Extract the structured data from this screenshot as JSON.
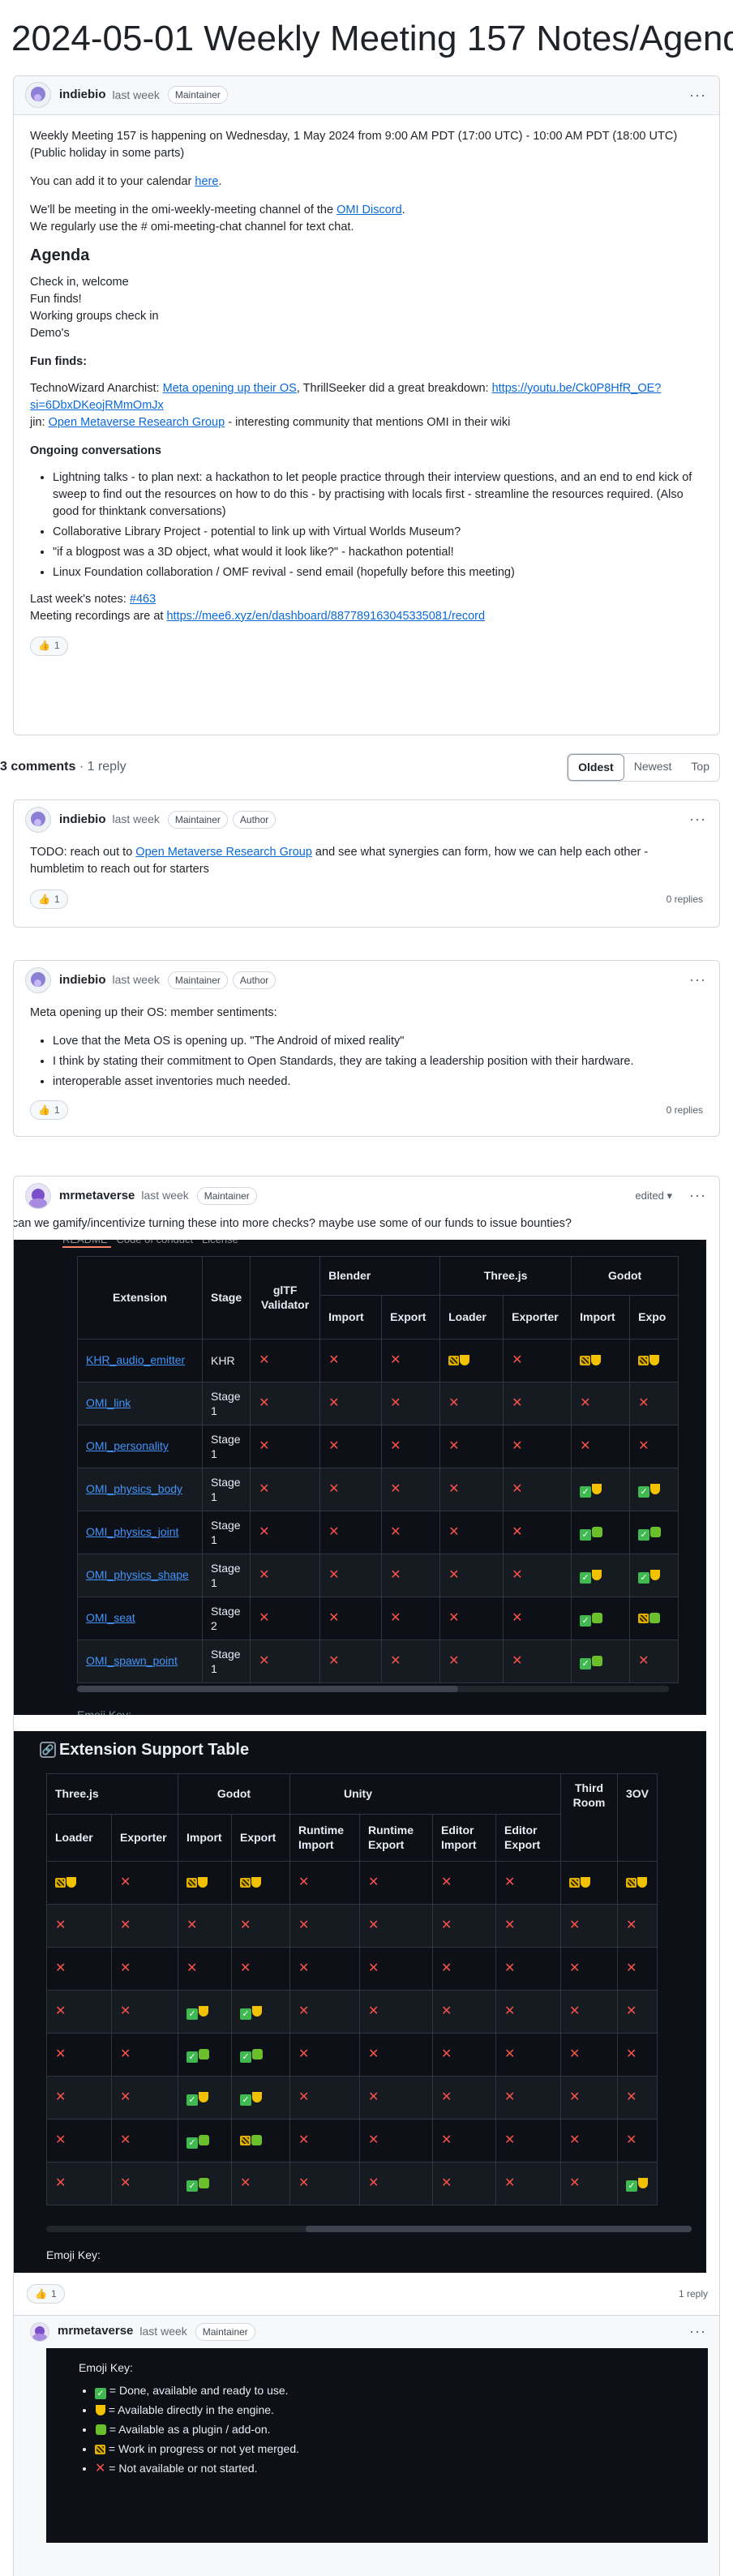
{
  "page_title": "2024-05-01 Weekly Meeting 157 Notes/Agenda",
  "post": {
    "author": "indiebio",
    "time": "last week",
    "badge": "Maintainer",
    "line1": "Weekly Meeting 157 is happening on Wednesday, 1 May 2024 from 9:00 AM PDT (17:00 UTC) - 10:00 AM PDT (18:00 UTC)",
    "line2": "(Public holiday in some parts)",
    "calendar_pre": "You can add it to your calendar ",
    "calendar_link": "here",
    "calendar_post": ".",
    "discord_pre": "We'll be meeting in the omi-weekly-meeting channel of the ",
    "discord_link": "OMI Discord",
    "discord_post": ".",
    "chat_line": "We regularly use the # omi-meeting-chat channel for text chat.",
    "agenda_heading": "Agenda",
    "agenda": [
      "Check in, welcome",
      "Fun finds!",
      "Working groups check in",
      "Demo's"
    ],
    "fun_heading": "Fun finds:",
    "fun1_pre": "TechnoWizard Anarchist: ",
    "fun1_link": "Meta opening up their OS",
    "fun1_mid": ", ThrillSeeker did a great breakdown: ",
    "fun1_url_a": "https://youtu.be/Ck0P8HfR_OE?",
    "fun1_url_b": "si=6DbxDKeojRMmOmJx",
    "fun2_pre": "jin: ",
    "fun2_link": "Open Metaverse Research Group",
    "fun2_post": " - interesting community that mentions OMI in their wiki",
    "ongoing_heading": "Ongoing conversations",
    "ongoing": [
      "Lightning talks - to plan next: a hackathon to let people practice through their interview questions, and an end to end kick of sweep to find out the resources on how to do this - by practising with locals first - streamline the resources required. (Also good for thinktank conversations)",
      "Collaborative Library Project - potential to link up with Virtual Worlds Museum?",
      "\"if a blogpost was a 3D object, what would it look like?\" - hackathon potential!",
      "Linux Foundation collaboration / OMF revival - send email (hopefully before this meeting)"
    ],
    "last_pre": "Last week's notes: ",
    "last_link": "#463",
    "rec_pre": "Meeting recordings are at ",
    "rec_link": "https://mee6.xyz/en/dashboard/887789163045335081/record",
    "reaction": "1"
  },
  "comments_bar": {
    "count": "3 comments",
    "replies": "· 1 reply",
    "sort": [
      "Oldest",
      "Newest",
      "Top"
    ]
  },
  "c1": {
    "author": "indiebio",
    "time": "last week",
    "badges": [
      "Maintainer",
      "Author"
    ],
    "pre": "TODO: reach out to ",
    "link": "Open Metaverse Research Group",
    "post": " and see what synergies can form, how we can help each other - humbletim to reach out for starters",
    "reaction": "1",
    "replies": "0 replies"
  },
  "c2": {
    "author": "indiebio",
    "time": "last week",
    "badges": [
      "Maintainer",
      "Author"
    ],
    "intro": "Meta opening up their OS: member sentiments:",
    "items": [
      "Love that the Meta OS is opening up. \"The Android of mixed reality\"",
      "I think by stating their commitment to Open Standards, they are taking a leadership position with their hardware.",
      "interoperable asset inventories much needed."
    ],
    "reaction": "1",
    "replies": "0 replies"
  },
  "c3": {
    "author": "mrmetaverse",
    "time": "last week",
    "badge": "Maintainer",
    "edited": "edited",
    "text": "can we gamify/incentivize turning these into more checks? maybe use some of our funds to issue bounties?",
    "tabs_partial": "README   Code of conduct   License",
    "t1_head1": [
      "Extension",
      "Stage",
      "glTF Validator",
      "Blender",
      "Three.js",
      "Godot"
    ],
    "t1_head2": [
      "Import",
      "Export",
      "Loader",
      "Exporter",
      "Import",
      "Expo"
    ],
    "t1_rows": [
      {
        "ext": "KHR_audio_emitter",
        "stage": "KHR"
      },
      {
        "ext": "OMI_link",
        "stage": "Stage 1"
      },
      {
        "ext": "OMI_personality",
        "stage": "Stage 1"
      },
      {
        "ext": "OMI_physics_body",
        "stage": "Stage 1"
      },
      {
        "ext": "OMI_physics_joint",
        "stage": "Stage 1"
      },
      {
        "ext": "OMI_physics_shape",
        "stage": "Stage 1"
      },
      {
        "ext": "OMI_seat",
        "stage": "Stage 2"
      },
      {
        "ext": "OMI_spawn_point",
        "stage": "Stage 1"
      }
    ],
    "t1_cells": [
      [
        "x",
        "x",
        "x",
        "wt",
        "x",
        "wt",
        "wt"
      ],
      [
        "x",
        "x",
        "x",
        "x",
        "x",
        "x",
        "x"
      ],
      [
        "x",
        "x",
        "x",
        "x",
        "x",
        "x",
        "x"
      ],
      [
        "x",
        "x",
        "x",
        "x",
        "x",
        "ot",
        "ot"
      ],
      [
        "x",
        "x",
        "x",
        "x",
        "x",
        "op",
        "op"
      ],
      [
        "x",
        "x",
        "x",
        "x",
        "x",
        "ot",
        "ot"
      ],
      [
        "x",
        "x",
        "x",
        "x",
        "x",
        "op",
        "wp"
      ],
      [
        "x",
        "x",
        "x",
        "x",
        "x",
        "op",
        "x"
      ]
    ],
    "emoji_key_cut": "Emoji Key:",
    "t2_title": "Extension Support Table",
    "t2_head1": [
      "Three.js",
      "Godot",
      "Unity",
      "Third Room",
      "3OV"
    ],
    "t2_head2": [
      "Loader",
      "Exporter",
      "Import",
      "Export",
      "Runtime Import",
      "Runtime Export",
      "Editor Import",
      "Editor Export"
    ],
    "t2_cells": [
      [
        "wt",
        "x",
        "wt",
        "wt",
        "x",
        "x",
        "x",
        "x",
        "wt",
        "wt"
      ],
      [
        "x",
        "x",
        "x",
        "x",
        "x",
        "x",
        "x",
        "x",
        "x",
        "x"
      ],
      [
        "x",
        "x",
        "x",
        "x",
        "x",
        "x",
        "x",
        "x",
        "x",
        "x"
      ],
      [
        "x",
        "x",
        "ot",
        "ot",
        "x",
        "x",
        "x",
        "x",
        "x",
        "x"
      ],
      [
        "x",
        "x",
        "op",
        "op",
        "x",
        "x",
        "x",
        "x",
        "x",
        "x"
      ],
      [
        "x",
        "x",
        "ot",
        "ot",
        "x",
        "x",
        "x",
        "x",
        "x",
        "x"
      ],
      [
        "x",
        "x",
        "op",
        "wp",
        "x",
        "x",
        "x",
        "x",
        "x",
        "x"
      ],
      [
        "x",
        "x",
        "op",
        "x",
        "x",
        "x",
        "x",
        "x",
        "x",
        "ot"
      ]
    ],
    "emoji_key": "Emoji Key:",
    "reaction": "1",
    "replies": "1 reply"
  },
  "reply": {
    "author": "mrmetaverse",
    "time": "last week",
    "badge": "Maintainer",
    "key_title": "Emoji Key:",
    "keys": [
      {
        "icon": "ok",
        "text": " = Done, available and ready to use."
      },
      {
        "icon": "tro",
        "text": " = Available directly in the engine."
      },
      {
        "icon": "pz",
        "text": " = Available as a plugin / add-on."
      },
      {
        "icon": "wip",
        "text": " = Work in progress or not yet merged."
      },
      {
        "icon": "x",
        "text": " = Not available or not started."
      }
    ]
  },
  "colors": {
    "link": "#0969da",
    "dark_bg": "#0d1117",
    "cross": "#f85149",
    "check": "#3fb950"
  }
}
